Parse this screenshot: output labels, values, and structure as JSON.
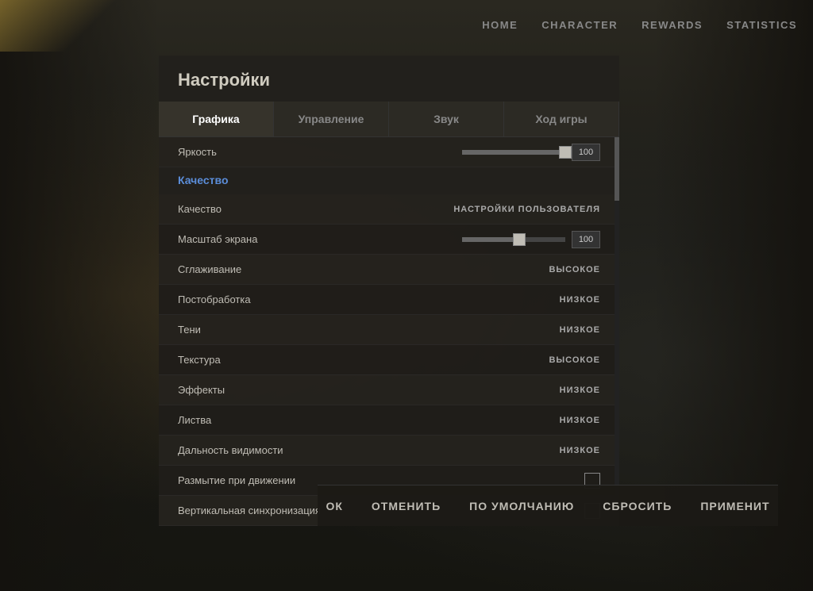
{
  "nav": {
    "items": [
      {
        "id": "home",
        "label": "HOME",
        "active": false
      },
      {
        "id": "character",
        "label": "CHARACTER",
        "active": false
      },
      {
        "id": "rewards",
        "label": "REWARDS",
        "active": false
      },
      {
        "id": "statistics",
        "label": "STATISTICS",
        "active": false
      }
    ]
  },
  "settings": {
    "title": "Настройки",
    "tabs": [
      {
        "id": "graphics",
        "label": "Графика",
        "active": true
      },
      {
        "id": "controls",
        "label": "Управление",
        "active": false
      },
      {
        "id": "sound",
        "label": "Звук",
        "active": false
      },
      {
        "id": "gameplay",
        "label": "Ход игры",
        "active": false
      }
    ],
    "brightness": {
      "label": "Яркость",
      "value": 100,
      "fill_percent": 100
    },
    "quality_section": {
      "label": "Качество"
    },
    "rows": [
      {
        "id": "quality",
        "label": "Качество",
        "value": "НАСТРОЙКИ ПОЛЬЗОВАТЕЛЯ",
        "type": "text"
      },
      {
        "id": "screen_scale",
        "label": "Масштаб экрана",
        "value": 100,
        "type": "slider",
        "fill_percent": 55
      },
      {
        "id": "antialiasing",
        "label": "Сглаживание",
        "value": "ВЫСОКОЕ",
        "type": "text"
      },
      {
        "id": "postprocess",
        "label": "Постобработка",
        "value": "НИЗКОЕ",
        "type": "text"
      },
      {
        "id": "shadows",
        "label": "Тени",
        "value": "НИЗКОЕ",
        "type": "text"
      },
      {
        "id": "texture",
        "label": "Текстура",
        "value": "ВЫСОКОЕ",
        "type": "text"
      },
      {
        "id": "effects",
        "label": "Эффекты",
        "value": "НИЗКОЕ",
        "type": "text"
      },
      {
        "id": "foliage",
        "label": "Листва",
        "value": "НИЗКОЕ",
        "type": "text"
      },
      {
        "id": "view_distance",
        "label": "Дальность видимости",
        "value": "НИЗКОЕ",
        "type": "text"
      },
      {
        "id": "motion_blur",
        "label": "Размытие при движении",
        "type": "checkbox",
        "checked": false
      },
      {
        "id": "vsync",
        "label": "Вертикальная синхронизация",
        "type": "checkbox",
        "checked": false
      }
    ],
    "bottom_buttons": [
      {
        "id": "ok",
        "label": "ОК"
      },
      {
        "id": "cancel",
        "label": "ОТМЕНИТЬ"
      },
      {
        "id": "default",
        "label": "ПО УМОЛЧАНИЮ"
      },
      {
        "id": "reset",
        "label": "СБРОСИТЬ"
      },
      {
        "id": "apply",
        "label": "ПРИМЕНИТ"
      }
    ]
  }
}
